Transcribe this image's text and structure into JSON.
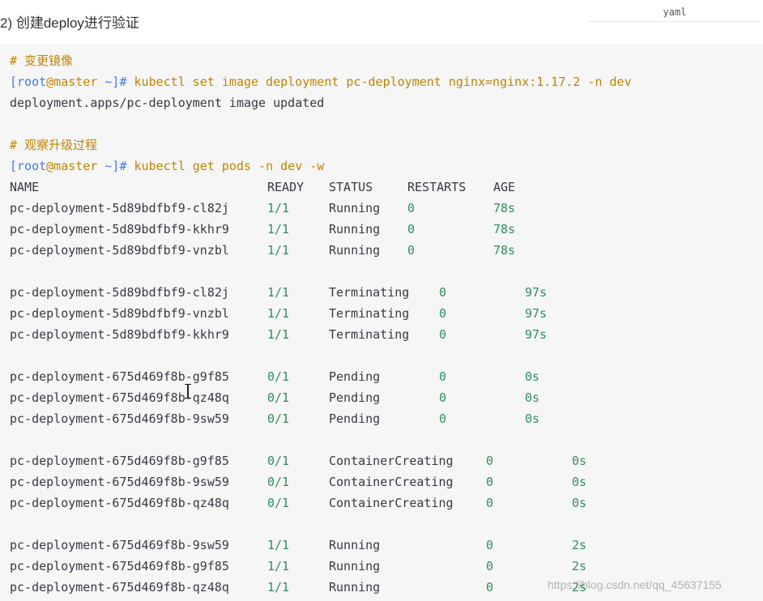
{
  "heading": "2) 创建deploy进行验证",
  "code_language": "yaml",
  "comment_1": "# 变更镜像",
  "cmd_1": {
    "prompt_user": "[root",
    "prompt_at_host": "@master",
    "prompt_tail": " ~]#",
    "command": " kubectl set image deployment pc-deployment nginx=nginx:1.17.2 -n dev"
  },
  "output_1": "deployment.apps/pc-deployment image updated",
  "comment_2": "# 观察升级过程",
  "cmd_2": {
    "prompt_user": "[root",
    "prompt_at_host": "@master",
    "prompt_tail": " ~]#",
    "command": " kubectl get pods -n dev -w"
  },
  "table_header": {
    "name": "NAME",
    "ready": "READY",
    "status": "STATUS",
    "restarts": "RESTARTS",
    "age": "AGE"
  },
  "groups": [
    [
      {
        "name": "pc-deployment-5d89bdfbf9-cl82j",
        "ready": "1/1",
        "status": "Running",
        "restarts": "0",
        "age": "78s"
      },
      {
        "name": "pc-deployment-5d89bdfbf9-kkhr9",
        "ready": "1/1",
        "status": "Running",
        "restarts": "0",
        "age": "78s"
      },
      {
        "name": "pc-deployment-5d89bdfbf9-vnzbl",
        "ready": "1/1",
        "status": "Running",
        "restarts": "0",
        "age": "78s"
      }
    ],
    [
      {
        "name": "pc-deployment-5d89bdfbf9-cl82j",
        "ready": "1/1",
        "status": "Terminating",
        "restarts": "0",
        "age": "97s"
      },
      {
        "name": "pc-deployment-5d89bdfbf9-vnzbl",
        "ready": "1/1",
        "status": "Terminating",
        "restarts": "0",
        "age": "97s"
      },
      {
        "name": "pc-deployment-5d89bdfbf9-kkhr9",
        "ready": "1/1",
        "status": "Terminating",
        "restarts": "0",
        "age": "97s"
      }
    ],
    [
      {
        "name": "pc-deployment-675d469f8b-g9f85",
        "ready": "0/1",
        "status": "Pending",
        "restarts": "0",
        "age": "0s"
      },
      {
        "name": "pc-deployment-675d469f8b-qz48q",
        "ready": "0/1",
        "status": "Pending",
        "restarts": "0",
        "age": "0s"
      },
      {
        "name": "pc-deployment-675d469f8b-9sw59",
        "ready": "0/1",
        "status": "Pending",
        "restarts": "0",
        "age": "0s"
      }
    ],
    [
      {
        "name": "pc-deployment-675d469f8b-g9f85",
        "ready": "0/1",
        "status": "ContainerCreating",
        "restarts": "0",
        "age": "0s"
      },
      {
        "name": "pc-deployment-675d469f8b-9sw59",
        "ready": "0/1",
        "status": "ContainerCreating",
        "restarts": "0",
        "age": "0s"
      },
      {
        "name": "pc-deployment-675d469f8b-qz48q",
        "ready": "0/1",
        "status": "ContainerCreating",
        "restarts": "0",
        "age": "0s"
      }
    ],
    [
      {
        "name": "pc-deployment-675d469f8b-9sw59",
        "ready": "1/1",
        "status": "Running",
        "restarts": "0",
        "age": "2s"
      },
      {
        "name": "pc-deployment-675d469f8b-g9f85",
        "ready": "1/1",
        "status": "Running",
        "restarts": "0",
        "age": "2s"
      },
      {
        "name": "pc-deployment-675d469f8b-qz48q",
        "ready": "1/1",
        "status": "Running",
        "restarts": "0",
        "age": "2s"
      }
    ]
  ],
  "watermark": "https://blog.csdn.net/qq_45637155",
  "cursor_icon": "text-cursor-icon"
}
